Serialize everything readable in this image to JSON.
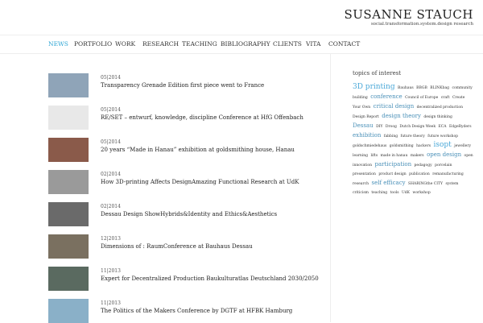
{
  "site": {
    "title": "SUSANNE STAUCH",
    "tagline": "social.transformation.system.design research"
  },
  "nav": [
    "NEWS",
    "PORTFOLIO",
    "WORK",
    "RESEARCH",
    "TEACHING",
    "BIBLIOGRAPHY",
    "CLIENTS",
    "VITA",
    "CONTACT"
  ],
  "posts": [
    {
      "date": "05|2014",
      "title": "Transparency Grenade Edition first piece went to France",
      "color": "#8fa4b8"
    },
    {
      "date": "05|2014",
      "title": "RE/SET – entwurf, knowledge, discipline Conference at HfG Offenbach",
      "color": "#e8e8e8"
    },
    {
      "date": "05|2014",
      "title": "20 years “Made in Hanau” exhibition at goldsmithing house, Hanau",
      "color": "#8a5a4a"
    },
    {
      "date": "02|2014",
      "title": "How 3D-printing Affects DesignAmazing Functional Research at UdK",
      "color": "#9a9a9a"
    },
    {
      "date": "02|2014",
      "title": "Dessau Design ShowHybrids&Identity and Ethics&Aesthetics",
      "color": "#6a6a6a"
    },
    {
      "date": "12|2013",
      "title": "Dimensions of : RaumConference at Bauhaus Dessau",
      "color": "#7a7060"
    },
    {
      "date": "11|2013",
      "title": "Expert for Decentralized Production Baukulturatlas Deutschland 2030/2050",
      "color": "#5a6a60"
    },
    {
      "date": "11|2013",
      "title": "The Politics of the Makers Conference by DGTF at HFBK Hamburg",
      "color": "#8ab0c8"
    }
  ],
  "sidebar": {
    "heading": "topics of interest",
    "tags": [
      [
        "3D printing",
        "bigger"
      ],
      [
        "Bauhaus"
      ],
      [
        "BBGB"
      ],
      [
        "BLINKbag"
      ],
      [
        "community building"
      ],
      [
        "conference",
        "big"
      ],
      [
        "Council of Europe"
      ],
      [
        "craft"
      ],
      [
        "Create Your Own"
      ],
      [
        "critical design",
        "big"
      ],
      [
        "decentralized production"
      ],
      [
        "Design Report"
      ],
      [
        "design theory",
        "big"
      ],
      [
        "design thinking"
      ],
      [
        "Dessau",
        "big"
      ],
      [
        "DIY"
      ],
      [
        "Droog"
      ],
      [
        "Dutch Design Week"
      ],
      [
        "ECA"
      ],
      [
        "EdgeRyders"
      ],
      [
        "exhibition",
        "big"
      ],
      [
        "fabbing"
      ],
      [
        "future theory"
      ],
      [
        "future workshop"
      ],
      [
        "goldschmiedehaus"
      ],
      [
        "goldsmithing"
      ],
      [
        "hackers"
      ],
      [
        "isopt",
        "bigger"
      ],
      [
        "jewellery"
      ],
      [
        "learning"
      ],
      [
        "lifts"
      ],
      [
        "made in hanau"
      ],
      [
        "makers"
      ],
      [
        "open design",
        "big"
      ],
      [
        "open innovation"
      ],
      [
        "participation",
        "big"
      ],
      [
        "pedagogy"
      ],
      [
        "porcelain"
      ],
      [
        "presentation"
      ],
      [
        "product design"
      ],
      [
        "publication"
      ],
      [
        "remanufacturing"
      ],
      [
        "research"
      ],
      [
        "self efficacy",
        "big"
      ],
      [
        "SHARINGthe CITY"
      ],
      [
        "system criticism"
      ],
      [
        "teaching"
      ],
      [
        "tools"
      ],
      [
        "UdK"
      ],
      [
        "workshop"
      ]
    ]
  }
}
